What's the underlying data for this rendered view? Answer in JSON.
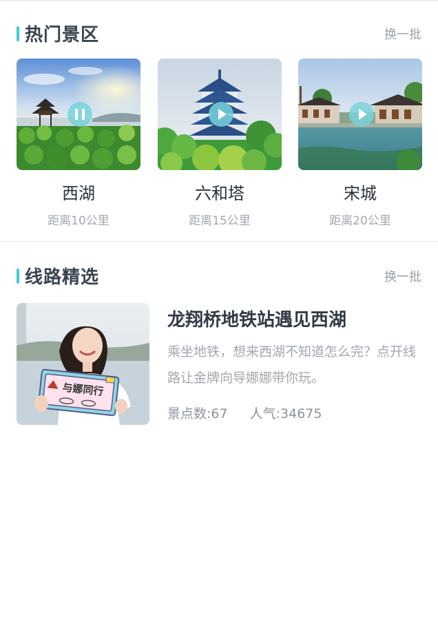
{
  "hot_spots": {
    "title": "热门景区",
    "more_label": "换一批",
    "items": [
      {
        "name": "西湖",
        "distance": "距离10公里",
        "media_state": "pause-icon"
      },
      {
        "name": "六和塔",
        "distance": "距离15公里",
        "media_state": "play-icon"
      },
      {
        "name": "宋城",
        "distance": "距离20公里",
        "media_state": "play-icon"
      }
    ]
  },
  "routes": {
    "title": "线路精选",
    "more_label": "换一批",
    "items": [
      {
        "title": "龙翔桥地铁站遇见西湖",
        "description": "乘坐地铁，想来西湖不知道怎么完？点开线路让金牌向导娜娜带你玩。",
        "spots_count": "景点数:67",
        "popularity": "人气:34675",
        "sign_text": "与娜同行"
      }
    ]
  },
  "colors": {
    "accent": "#3ecbd6",
    "title": "#3a4350",
    "muted": "#a3a8af"
  }
}
